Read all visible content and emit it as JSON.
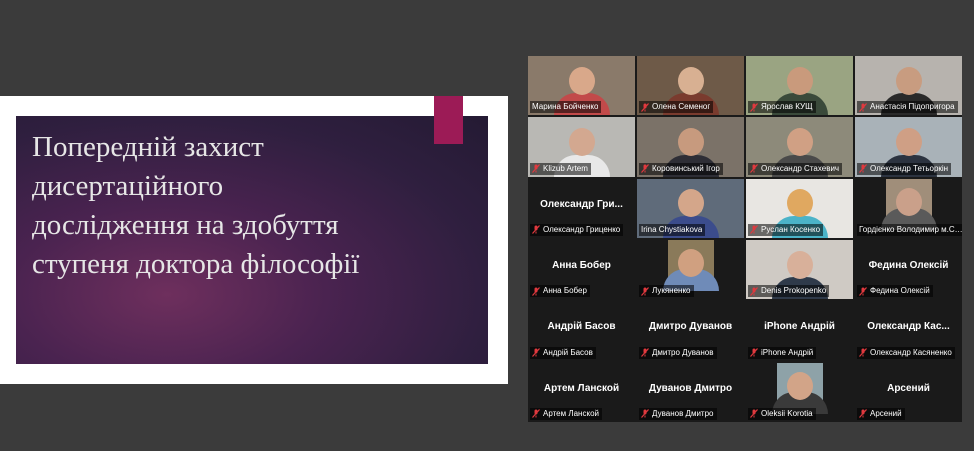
{
  "slide": {
    "title_lines": [
      "Попередній захист",
      "дисертаційного",
      "дослідження на здобуття",
      "ступеня доктора філософії"
    ]
  },
  "colors": {
    "active_speaker_border": "#23d96b",
    "muted_icon": "#e0393e",
    "slide_accent": "#9c1b56"
  },
  "participants": [
    {
      "label": "Марина Бойченко",
      "tile_name": "",
      "video": true,
      "active": true,
      "bg": "#8a7a6a",
      "skin": "#d9a88a",
      "shirt": "#c24a4a",
      "muted": false
    },
    {
      "label": "Олена Семеног",
      "tile_name": "",
      "video": true,
      "bg": "#6e5a48",
      "skin": "#d8b092",
      "shirt": "#7a3b2e",
      "muted": true
    },
    {
      "label": "Ярослав КУЩ",
      "tile_name": "",
      "video": true,
      "bg": "#9aa482",
      "skin": "#c99a7c",
      "shirt": "#3a4a3a",
      "muted": true
    },
    {
      "label": "Анастасія Підопригора",
      "tile_name": "",
      "video": true,
      "bg": "#b7b3ae",
      "skin": "#c89c80",
      "shirt": "#2a2a2a",
      "muted": true
    },
    {
      "label": "Klizub Artem",
      "tile_name": "",
      "video": true,
      "bg": "#b9b8b4",
      "skin": "#d3a890",
      "shirt": "#e8e8e8",
      "muted": true
    },
    {
      "label": "Коровинський Ігор",
      "tile_name": "",
      "video": true,
      "bg": "#7b7268",
      "skin": "#c79a7e",
      "shirt": "#2e2e36",
      "muted": true
    },
    {
      "label": "Олександр Стахевич",
      "tile_name": "",
      "video": true,
      "bg": "#8d8a7a",
      "skin": "#d0a084",
      "shirt": "#4a4a4a",
      "muted": true
    },
    {
      "label": "Олександр Тетьоркін",
      "tile_name": "",
      "video": true,
      "bg": "#a9b2b8",
      "skin": "#cf9f85",
      "shirt": "#2c3340",
      "muted": true
    },
    {
      "label": "Олександр Гриценко",
      "tile_name": "Олександр Гри...",
      "video": false,
      "muted": true
    },
    {
      "label": "Irina Chystiakova",
      "tile_name": "",
      "video": true,
      "bg": "#5f6b7a",
      "skin": "#d4a68a",
      "shirt": "#3b4c8c",
      "muted": false
    },
    {
      "label": "Руслан Косенко",
      "tile_name": "",
      "video": true,
      "bg": "#e8e6e2",
      "skin": "#e0a860",
      "shirt": "#4bb3c8",
      "muted": true
    },
    {
      "label": "Гордієнко Володимир м.Сум...",
      "tile_name": "",
      "video": true,
      "small": true,
      "bg": "#a08e7a",
      "skin": "#caa08a",
      "shirt": "#5a5a5a",
      "muted": false
    },
    {
      "label": "Анна Бобер",
      "tile_name": "Анна Бобер",
      "video": false,
      "muted": true
    },
    {
      "label": "Лукяненко",
      "tile_name": "",
      "video": true,
      "small": true,
      "bg": "#8a7a5a",
      "skin": "#d0a080",
      "shirt": "#6f8bb8",
      "muted": true
    },
    {
      "label": "Denis Prokopenko",
      "tile_name": "",
      "video": true,
      "bg": "#cfcac4",
      "skin": "#d8b09a",
      "shirt": "#2f3a4a",
      "muted": true
    },
    {
      "label": "Федина Олексій",
      "tile_name": "Федина Олексій",
      "video": false,
      "muted": true
    },
    {
      "label": "Андрій Басов",
      "tile_name": "Андрій Басов",
      "video": false,
      "muted": true
    },
    {
      "label": "Дмитро Дуванов",
      "tile_name": "Дмитро Дуванов",
      "video": false,
      "muted": true
    },
    {
      "label": "iPhone Андрій",
      "tile_name": "iPhone Андрій",
      "video": false,
      "muted": true
    },
    {
      "label": "Олександр Касяненко",
      "tile_name": "Олександр Кас...",
      "video": false,
      "muted": true
    },
    {
      "label": "Артем Ланской",
      "tile_name": "Артем Ланской",
      "video": false,
      "muted": true
    },
    {
      "label": "Дуванов Дмитро",
      "tile_name": "Дуванов Дмитро",
      "video": false,
      "muted": true
    },
    {
      "label": "Oleksii Korotia",
      "tile_name": "",
      "video": true,
      "small": true,
      "bg": "#8ea2a8",
      "skin": "#d2a488",
      "shirt": "#3a3a3a",
      "muted": true
    },
    {
      "label": "Арсений",
      "tile_name": "Арсений",
      "video": false,
      "muted": true
    }
  ]
}
